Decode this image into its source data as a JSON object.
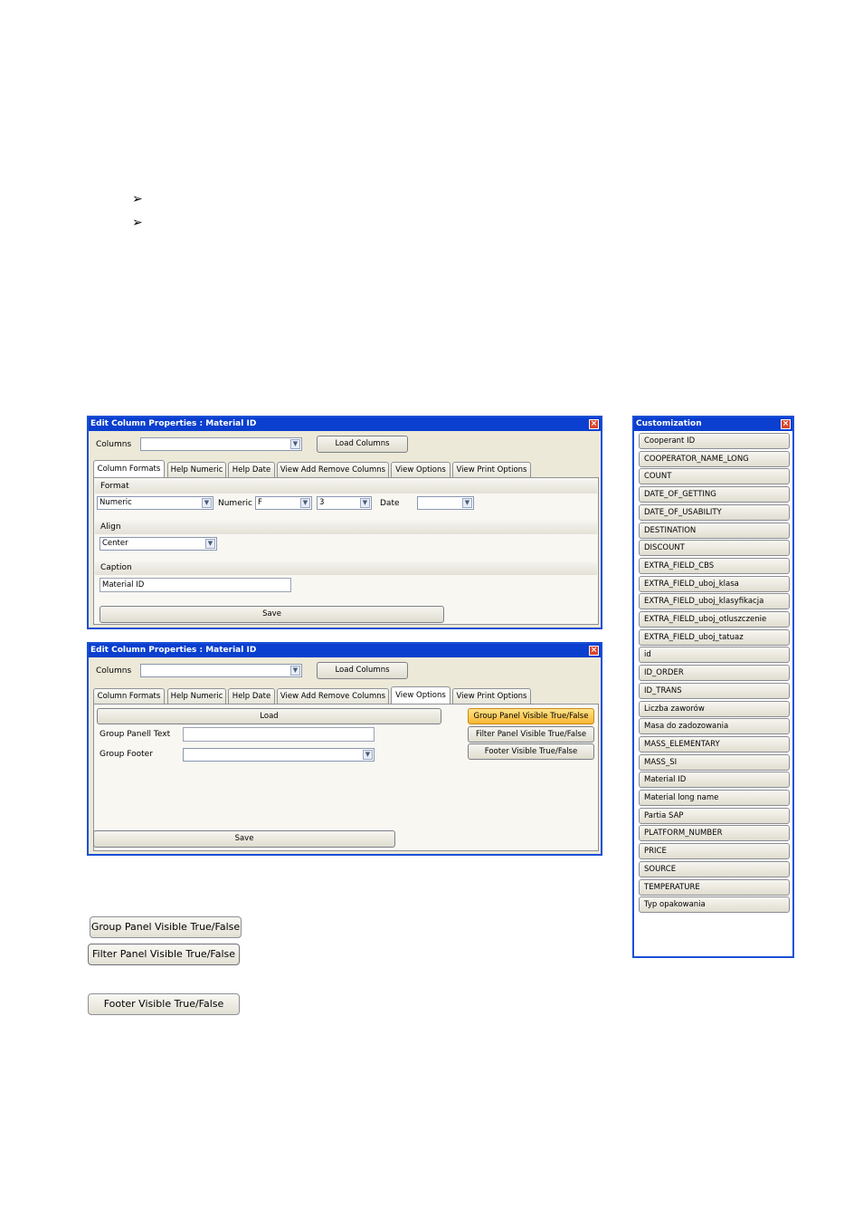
{
  "edit_window_1": {
    "title": "Edit Column Properties : Material ID",
    "columns_label": "Columns",
    "columns_value": "",
    "load_columns_label": "Load Columns",
    "tabs": [
      "Column Formats",
      "Help Numeric",
      "Help Date",
      "View Add Remove Columns",
      "View Options",
      "View Print Options"
    ],
    "active_tab": "Column Formats",
    "format_section": "Format",
    "format_value": "Numeric",
    "numeric_label": "Numeric",
    "numeric_format_value": "F",
    "numeric_precision_value": "3",
    "date_label": "Date",
    "date_value": "",
    "align_section": "Align",
    "align_value": "Center",
    "caption_section": "Caption",
    "caption_value": "Material ID",
    "save_label": "Save"
  },
  "edit_window_2": {
    "title": "Edit Column Properties : Material ID",
    "columns_label": "Columns",
    "columns_value": "",
    "load_columns_label": "Load Columns",
    "tabs": [
      "Column Formats",
      "Help Numeric",
      "Help Date",
      "View Add Remove Columns",
      "View Options",
      "View Print Options"
    ],
    "active_tab": "View Options",
    "load_label": "Load",
    "group_panel_text_label": "Group Panell Text",
    "group_panel_text_value": "",
    "group_footer_label": "Group Footer",
    "group_footer_value": "",
    "group_panel_visible_label": "Group Panel Visible True/False",
    "filter_panel_visible_label": "Filter Panel Visible True/False",
    "footer_visible_label": "Footer Visible True/False",
    "save_label": "Save"
  },
  "customization": {
    "title": "Customization",
    "items": [
      "Cooperant ID",
      "COOPERATOR_NAME_LONG",
      "COUNT",
      "DATE_OF_GETTING",
      "DATE_OF_USABILITY",
      "DESTINATION",
      "DISCOUNT",
      "EXTRA_FIELD_CBS",
      "EXTRA_FIELD_uboj_klasa",
      "EXTRA_FIELD_uboj_klasyfikacja",
      "EXTRA_FIELD_uboj_otluszczenie",
      "EXTRA_FIELD_uboj_tatuaz",
      "id",
      "ID_ORDER",
      "ID_TRANS",
      "Liczba zaworów",
      "Masa do zadozowania",
      "MASS_ELEMENTARY",
      "MASS_SI",
      "Material ID",
      "Material long name",
      "Partia SAP",
      "PLATFORM_NUMBER",
      "PRICE",
      "SOURCE",
      "TEMPERATURE",
      "Typ opakowania"
    ]
  },
  "standalone_buttons": {
    "group_panel": "Group Panel Visible True/False",
    "filter_panel": "Filter Panel Visible True/False",
    "footer": "Footer Visible True/False"
  },
  "bullets": [
    "➢",
    "➢"
  ],
  "colors": {
    "titlebar": "#0a3fcf",
    "window_bg": "#ece9d8",
    "highlight_button": "#f7b733"
  }
}
